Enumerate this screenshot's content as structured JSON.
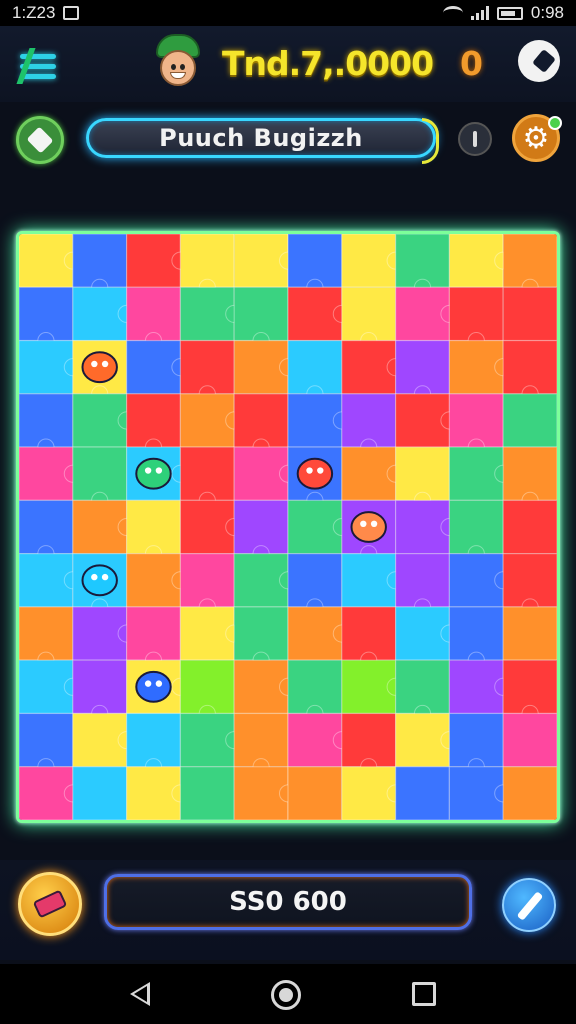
{
  "status_bar": {
    "time": "1:Z23",
    "battery": "0:98"
  },
  "header": {
    "currency_value": "Tnd.7,.0000",
    "secondary_count": "0"
  },
  "title_bar": {
    "title": "Puuch Bugizzh"
  },
  "bottom": {
    "score": "SS0 600"
  },
  "board": {
    "columns": 10,
    "rows": 11,
    "palette": [
      "#ffe83a",
      "#2f6cff",
      "#ff2e2e",
      "#ff8a1e",
      "#2ed17a",
      "#1ec8ff",
      "#9a3cff",
      "#ff3c9a",
      "#7cf01e",
      "#3a3ad6"
    ],
    "tiles": [
      [
        0,
        1,
        2,
        0,
        0,
        1,
        0,
        4,
        0,
        3
      ],
      [
        1,
        5,
        7,
        4,
        4,
        2,
        0,
        7,
        2,
        2
      ],
      [
        5,
        0,
        1,
        2,
        3,
        5,
        2,
        6,
        3,
        2
      ],
      [
        1,
        4,
        2,
        3,
        2,
        1,
        6,
        2,
        7,
        4
      ],
      [
        7,
        4,
        5,
        2,
        7,
        1,
        3,
        0,
        4,
        3
      ],
      [
        1,
        3,
        0,
        2,
        6,
        4,
        6,
        6,
        4,
        2
      ],
      [
        5,
        5,
        3,
        7,
        4,
        1,
        5,
        6,
        1,
        2
      ],
      [
        3,
        6,
        7,
        0,
        4,
        3,
        2,
        5,
        1,
        3
      ],
      [
        5,
        6,
        0,
        8,
        3,
        4,
        8,
        4,
        6,
        2
      ],
      [
        1,
        0,
        5,
        4,
        3,
        7,
        2,
        0,
        1,
        7
      ],
      [
        7,
        5,
        0,
        4,
        3,
        3,
        0,
        1,
        1,
        3
      ]
    ],
    "creatures": [
      "bug",
      "blue-star",
      "cyan-creature",
      "orange-fish",
      "fish",
      "bug"
    ]
  }
}
